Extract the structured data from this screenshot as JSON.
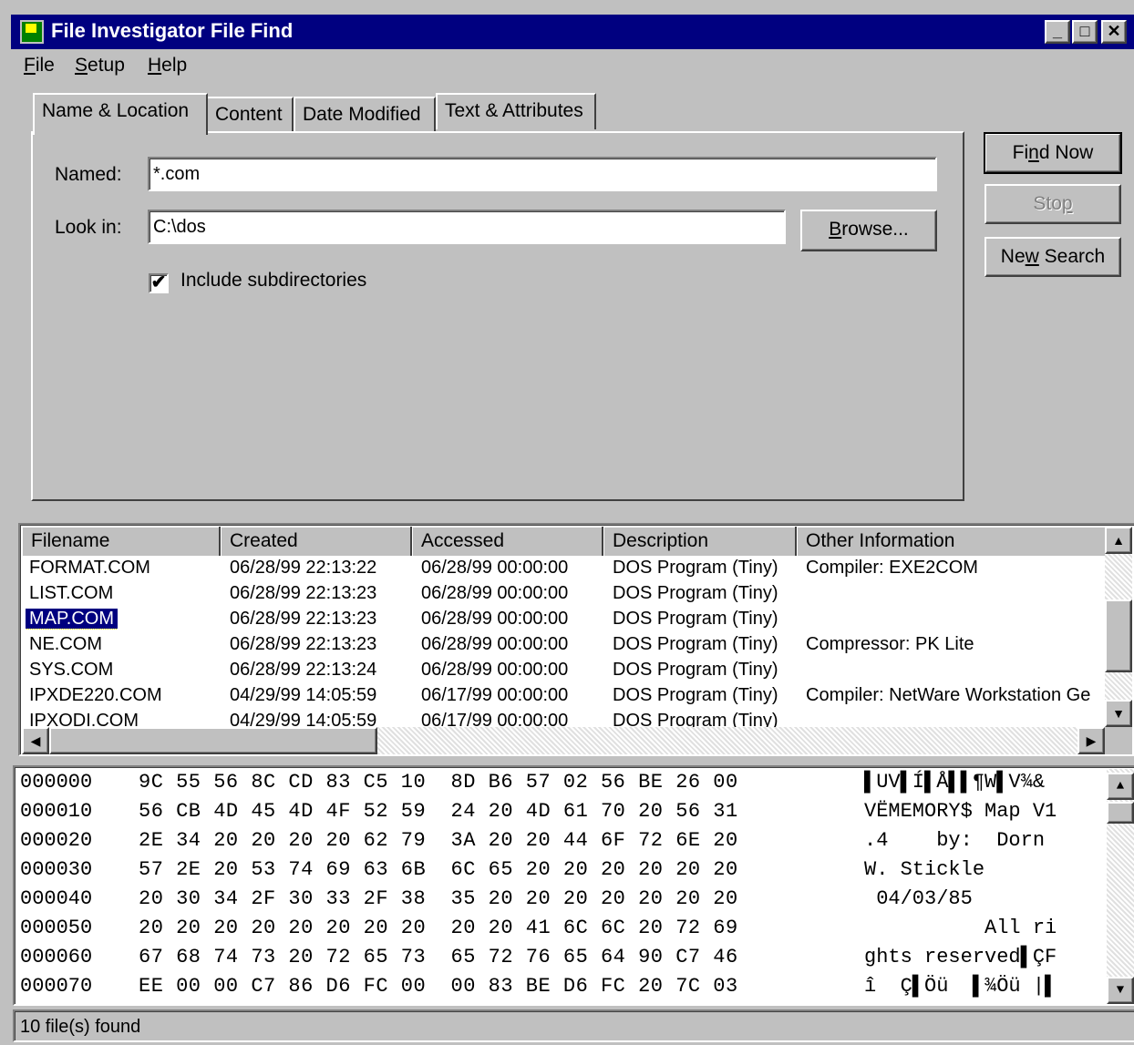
{
  "window": {
    "title": "File Investigator File Find"
  },
  "menu": [
    {
      "pre": "",
      "u": "F",
      "post": "ile"
    },
    {
      "pre": "",
      "u": "S",
      "post": "etup"
    },
    {
      "pre": "",
      "u": "H",
      "post": "elp"
    }
  ],
  "tabs": [
    "Name & Location",
    "Content",
    "Date Modified",
    "Text & Attributes"
  ],
  "form": {
    "named_label": "Named:",
    "named_value": "*.com",
    "lookin_label": "Look in:",
    "lookin_value": "C:\\dos",
    "browse_label": "Browse...",
    "include_subdirs_label": "Include subdirectories",
    "include_subdirs_checked": "✔"
  },
  "actions": {
    "find_now": "Find Now",
    "stop": "Stop",
    "new_search": "New Search"
  },
  "results": {
    "columns": [
      "Filename",
      "Created",
      "Accessed",
      "Description",
      "Other Information"
    ],
    "rows": [
      [
        "FORMAT.COM",
        "06/28/99 22:13:22",
        "06/28/99 00:00:00",
        "DOS Program (Tiny)",
        "Compiler: EXE2COM"
      ],
      [
        "LIST.COM",
        "06/28/99 22:13:23",
        "06/28/99 00:00:00",
        "DOS Program (Tiny)",
        ""
      ],
      [
        "MAP.COM",
        "06/28/99 22:13:23",
        "06/28/99 00:00:00",
        "DOS Program (Tiny)",
        ""
      ],
      [
        "NE.COM",
        "06/28/99 22:13:23",
        "06/28/99 00:00:00",
        "DOS Program (Tiny)",
        "Compressor: PK Lite"
      ],
      [
        "SYS.COM",
        "06/28/99 22:13:24",
        "06/28/99 00:00:00",
        "DOS Program (Tiny)",
        ""
      ],
      [
        "IPXDE220.COM",
        "04/29/99 14:05:59",
        "06/17/99 00:00:00",
        "DOS Program (Tiny)",
        "Compiler: NetWare Workstation Ge"
      ],
      [
        "IPXODI.COM",
        "04/29/99 14:05:59",
        "06/17/99 00:00:00",
        "DOS Program (Tiny)",
        ""
      ]
    ]
  },
  "hex": [
    {
      "off": "000000",
      "bytes": "9C 55 56 8C CD 83 C5 10  8D B6 57 02 56 BE 26 00",
      "ascii": "▌UV▌Í▌Å▌▌¶W▌V¾&"
    },
    {
      "off": "000010",
      "bytes": "56 CB 4D 45 4D 4F 52 59  24 20 4D 61 70 20 56 31",
      "ascii": "VËMEMORY$ Map V1"
    },
    {
      "off": "000020",
      "bytes": "2E 34 20 20 20 20 62 79  3A 20 20 44 6F 72 6E 20",
      "ascii": ".4    by:  Dorn "
    },
    {
      "off": "000030",
      "bytes": "57 2E 20 53 74 69 63 6B  6C 65 20 20 20 20 20 20",
      "ascii": "W. Stickle      "
    },
    {
      "off": "000040",
      "bytes": "20 30 34 2F 30 33 2F 38  35 20 20 20 20 20 20 20",
      "ascii": " 04/03/85       "
    },
    {
      "off": "000050",
      "bytes": "20 20 20 20 20 20 20 20  20 20 41 6C 6C 20 72 69",
      "ascii": "          All ri"
    },
    {
      "off": "000060",
      "bytes": "67 68 74 73 20 72 65 73  65 72 76 65 64 90 C7 46",
      "ascii": "ghts reserved▌ÇF"
    },
    {
      "off": "000070",
      "bytes": "EE 00 00 C7 86 D6 FC 00  00 83 BE D6 FC 20 7C 03",
      "ascii": "î  Ç▌Öü  ▌¾Öü |▌"
    }
  ],
  "status": "10 file(s) found"
}
